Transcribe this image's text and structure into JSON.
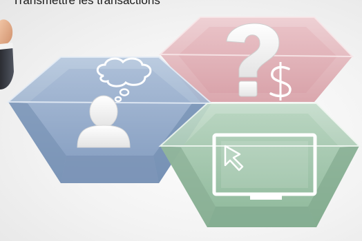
{
  "slide": {
    "caption": "Transmettre les transactions"
  },
  "icons": {
    "question_mark": "question-mark-icon",
    "dollar_sign": "dollar-sign-icon",
    "thinking_person": "thinking-person-icon",
    "thought_bubble": "thought-bubble-icon",
    "monitor_cursor": "monitor-with-cursor-icon",
    "hand": "hand-in-suit-sleeve"
  },
  "colors": {
    "blue_hex": "#8fa7c6",
    "red_hex": "#dcaab0",
    "green_hex": "#9fc3a7",
    "background": "#f1f1f1"
  }
}
